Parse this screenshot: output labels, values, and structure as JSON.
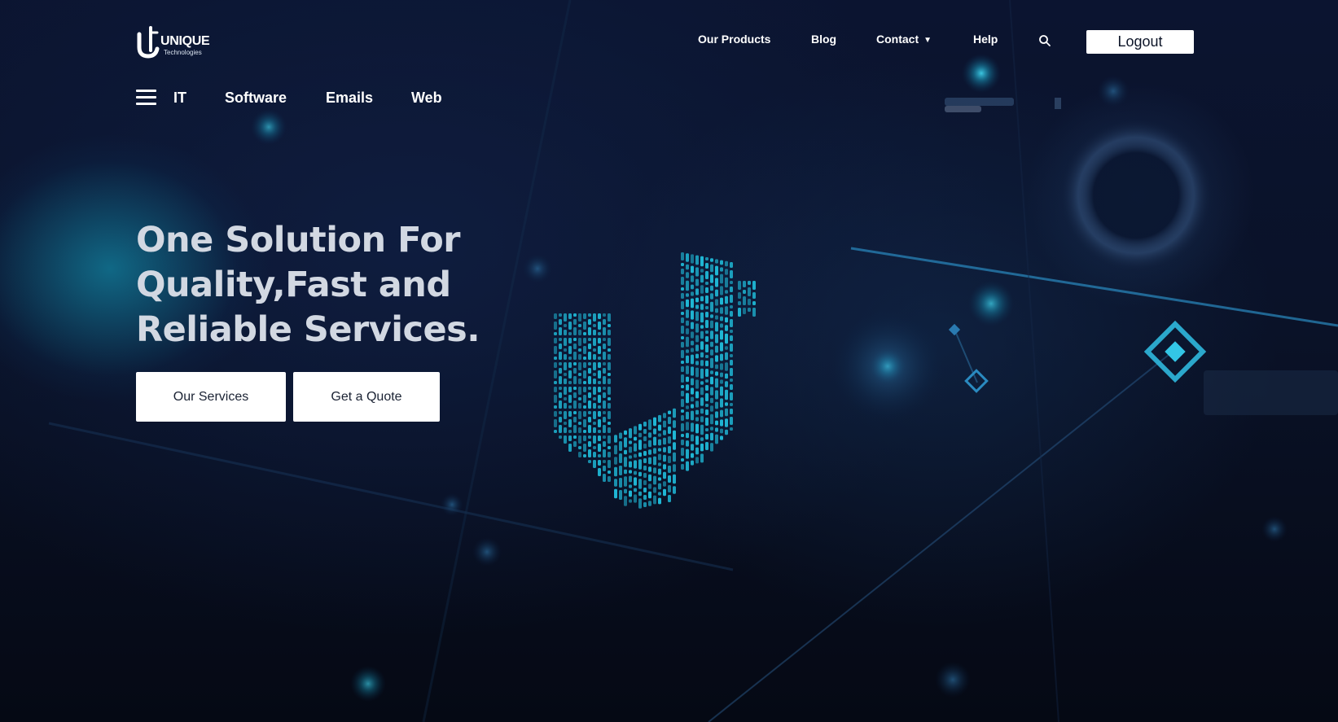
{
  "brand": {
    "name": "UNIQUE",
    "tagline": "Technologies",
    "accent_color": "#1fb6d4"
  },
  "header": {
    "nav": [
      {
        "label": "Our Products"
      },
      {
        "label": "Blog"
      },
      {
        "label": "Contact",
        "has_dropdown": true
      },
      {
        "label": "Help"
      }
    ],
    "search_icon": "search-icon",
    "logout_label": "Logout"
  },
  "sub_nav": {
    "menu_icon": "hamburger-icon",
    "items": [
      {
        "label": "IT"
      },
      {
        "label": "Software"
      },
      {
        "label": "Emails"
      },
      {
        "label": "Web"
      }
    ]
  },
  "hero": {
    "title_lines": [
      "One Solution For",
      "Quality,Fast and",
      "Reliable Services."
    ],
    "primary_button": "Our Services",
    "secondary_button": "Get a Quote"
  }
}
